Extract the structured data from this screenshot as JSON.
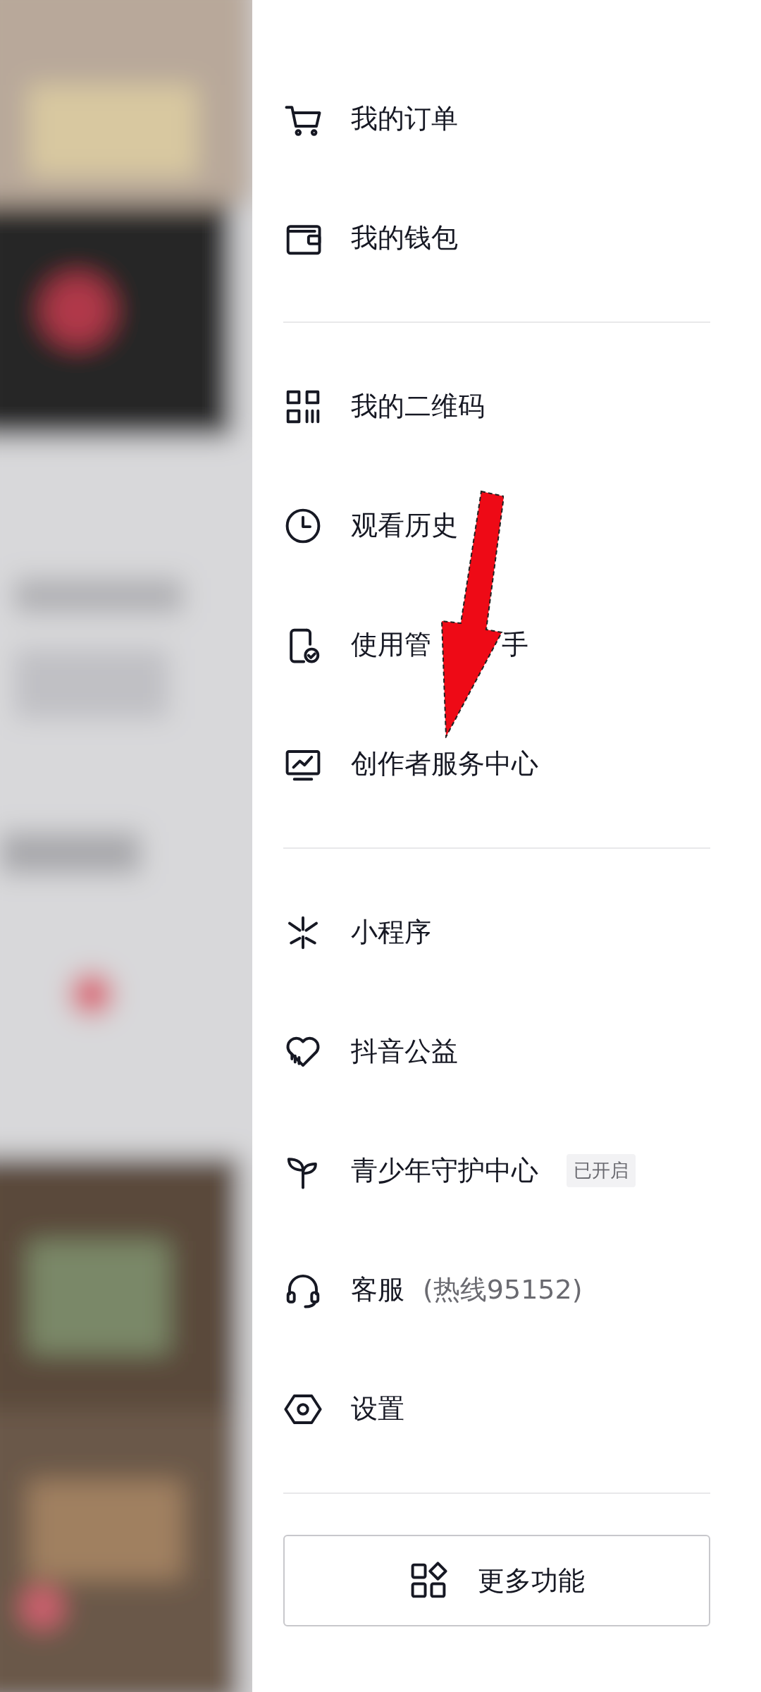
{
  "menu_groups": [
    {
      "items": [
        {
          "label": "我的订单"
        },
        {
          "label": "我的钱包"
        }
      ]
    },
    {
      "items": [
        {
          "label": "我的二维码"
        },
        {
          "label": "观看历史"
        },
        {
          "label": "使用管",
          "label_end": "手"
        },
        {
          "label": "创作者服务中心"
        }
      ]
    },
    {
      "items": [
        {
          "label": "小程序"
        },
        {
          "label": "抖音公益"
        },
        {
          "label": "青少年守护中心",
          "badge": "已开启"
        },
        {
          "label": "客服",
          "note": "(热线95152)"
        },
        {
          "label": "设置"
        }
      ]
    }
  ],
  "more_button": {
    "label": "更多功能"
  }
}
